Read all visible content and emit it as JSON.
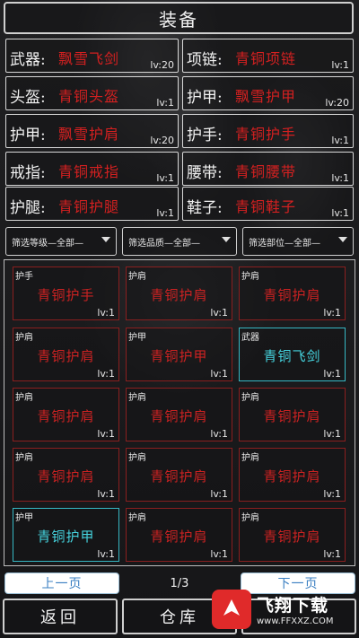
{
  "title": "装备",
  "equipment": [
    {
      "label": "武器:",
      "name": "飘雪飞剑",
      "level": "lv:20"
    },
    {
      "label": "项链:",
      "name": "青铜项链",
      "level": "lv:1"
    },
    {
      "label": "头盔:",
      "name": "青铜头盔",
      "level": "lv:1"
    },
    {
      "label": "护甲:",
      "name": "飘雪护甲",
      "level": "lv:20"
    },
    {
      "label": "护甲:",
      "name": "飘雪护肩",
      "level": "lv:20"
    },
    {
      "label": "护手:",
      "name": "青铜护手",
      "level": "lv:1"
    },
    {
      "label": "戒指:",
      "name": "青铜戒指",
      "level": "lv:1"
    },
    {
      "label": "腰带:",
      "name": "青铜腰带",
      "level": "lv:1"
    },
    {
      "label": "护腿:",
      "name": "青铜护腿",
      "level": "lv:1"
    },
    {
      "label": "鞋子:",
      "name": "青铜鞋子",
      "level": "lv:1"
    }
  ],
  "filters": [
    {
      "label": "筛选等级—全部—"
    },
    {
      "label": "筛选品质—全部—"
    },
    {
      "label": "筛选部位—全部—"
    }
  ],
  "inventory": [
    {
      "type": "护手",
      "name": "青铜护手",
      "level": "lv:1",
      "rarity": "red"
    },
    {
      "type": "护肩",
      "name": "青铜护肩",
      "level": "lv:1",
      "rarity": "red"
    },
    {
      "type": "护肩",
      "name": "青铜护肩",
      "level": "lv:1",
      "rarity": "red"
    },
    {
      "type": "护肩",
      "name": "青铜护肩",
      "level": "lv:1",
      "rarity": "red"
    },
    {
      "type": "护甲",
      "name": "青铜护甲",
      "level": "lv:1",
      "rarity": "red"
    },
    {
      "type": "武器",
      "name": "青铜飞剑",
      "level": "lv:1",
      "rarity": "cyan"
    },
    {
      "type": "护肩",
      "name": "青铜护肩",
      "level": "lv:1",
      "rarity": "red"
    },
    {
      "type": "护肩",
      "name": "青铜护肩",
      "level": "lv:1",
      "rarity": "red"
    },
    {
      "type": "护肩",
      "name": "青铜护肩",
      "level": "lv:1",
      "rarity": "red"
    },
    {
      "type": "护肩",
      "name": "青铜护肩",
      "level": "lv:1",
      "rarity": "red"
    },
    {
      "type": "护肩",
      "name": "青铜护肩",
      "level": "lv:1",
      "rarity": "red"
    },
    {
      "type": "护肩",
      "name": "青铜护肩",
      "level": "lv:1",
      "rarity": "red"
    },
    {
      "type": "护甲",
      "name": "青铜护甲",
      "level": "lv:1",
      "rarity": "cyan"
    },
    {
      "type": "护肩",
      "name": "青铜护肩",
      "level": "lv:1",
      "rarity": "red"
    },
    {
      "type": "护肩",
      "name": "青铜护肩",
      "level": "lv:1",
      "rarity": "red"
    }
  ],
  "pagination": {
    "prev": "上一页",
    "next": "下一页",
    "page": "1/3"
  },
  "bottom": {
    "back": "返回",
    "warehouse": "仓库"
  },
  "watermark": {
    "brand": "飞翔下载",
    "url": "www.FFXXZ.COM"
  },
  "colors": {
    "rare_red": "#cc2222",
    "rare_cyan": "#45d3de",
    "border_red": "#8a1f1f",
    "border_cyan": "#36b8c4"
  }
}
